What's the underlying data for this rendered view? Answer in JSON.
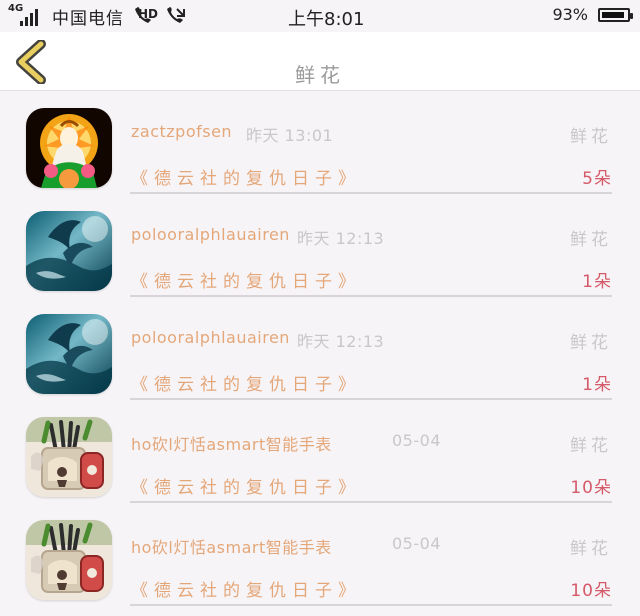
{
  "status_bar": {
    "network": "4G",
    "carrier": "中国电信",
    "hd": "HD",
    "time": "上午8:01",
    "battery": "93%",
    "battery_level": 0.93
  },
  "header": {
    "title": "鲜花"
  },
  "items": [
    {
      "user": "zactzpofsen",
      "time": "昨天 13:01",
      "type": "鲜花",
      "book": "《德云社的复仇日子》",
      "count": "5朵",
      "avatar": "buddha-avatar"
    },
    {
      "user": "polooralphlauairen",
      "time": "昨天 12:13",
      "type": "鲜花",
      "book": "《德云社的复仇日子》",
      "count": "1朵",
      "avatar": "ocean-avatar"
    },
    {
      "user": "polooralphlauairen",
      "time": "昨天 12:13",
      "type": "鲜花",
      "book": "《德云社的复仇日子》",
      "count": "1朵",
      "avatar": "ocean-avatar"
    },
    {
      "user": "ho砍l灯恬asmart智能手表",
      "time": "05-04",
      "type": "鲜花",
      "book": "《德云社的复仇日子》",
      "count": "10朵",
      "avatar": "pen-holder-avatar"
    },
    {
      "user": "ho砍l灯恬asmart智能手表",
      "time": "05-04",
      "type": "鲜花",
      "book": "《德云社的复仇日子》",
      "count": "10朵",
      "avatar": "pen-holder-avatar"
    }
  ],
  "colors": {
    "accent_text": "#e4a779",
    "count_text": "#d55a69",
    "muted_text": "#c8c8c8",
    "back_icon": "#e8cf5f"
  }
}
